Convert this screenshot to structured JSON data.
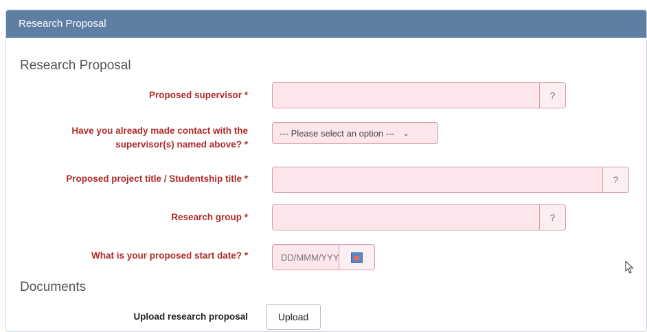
{
  "panel": {
    "title": "Research Proposal"
  },
  "research_section": {
    "title": "Research Proposal"
  },
  "fields": {
    "supervisor": {
      "label": "Proposed supervisor *",
      "value": "",
      "help": "?"
    },
    "contact": {
      "label": "Have you already made contact with the supervisor(s) named above? *",
      "selected": "--- Please select an option ---"
    },
    "project_title": {
      "label": "Proposed project title / Studentship title *",
      "value": "",
      "help": "?"
    },
    "research_group": {
      "label": "Research group *",
      "value": "",
      "help": "?"
    },
    "start_date": {
      "label": "What is your proposed start date? *",
      "placeholder": "DD/MMM/YYYY"
    }
  },
  "documents_section": {
    "title": "Documents"
  },
  "upload": {
    "label": "Upload research proposal",
    "button": "Upload"
  },
  "colors": {
    "header": "#5e7ea3",
    "required_label": "#b02a2a",
    "invalid_bg": "#fde6ec"
  }
}
